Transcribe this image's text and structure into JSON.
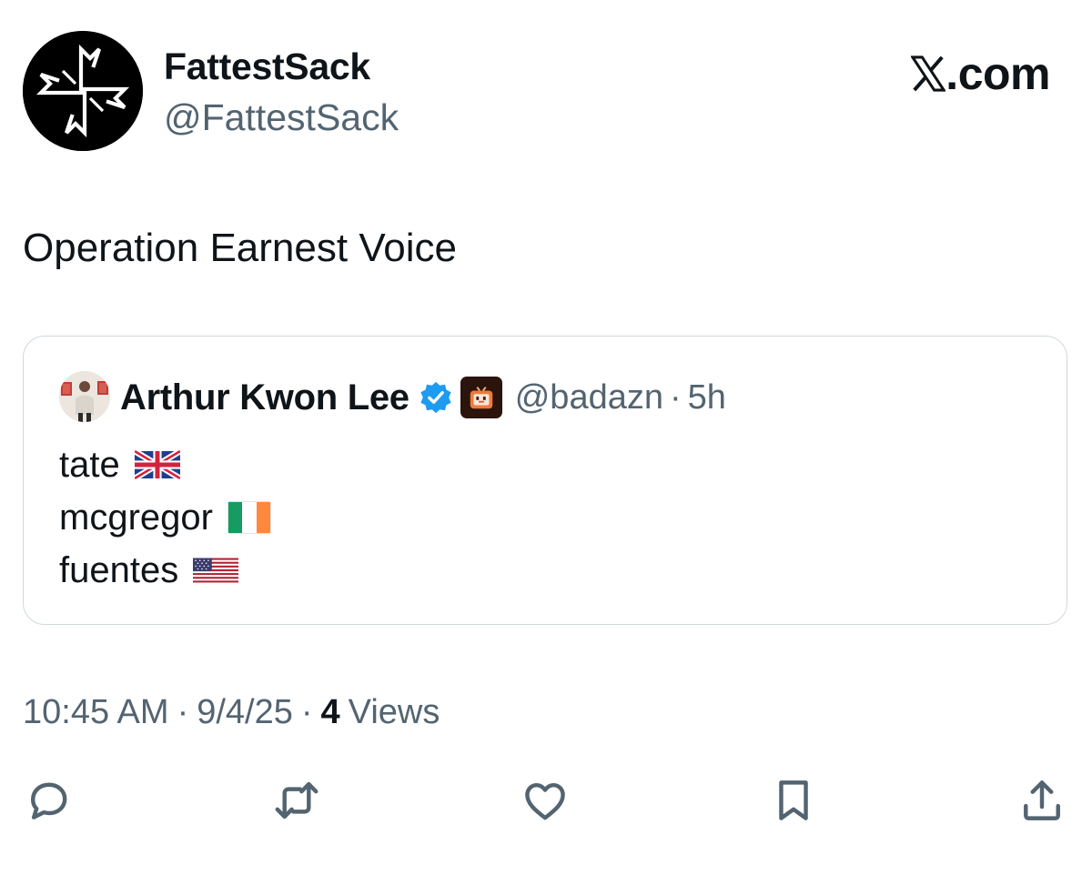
{
  "author": {
    "display_name": "FattestSack",
    "handle": "@FattestSack",
    "avatar_icon": "compass-star-logo"
  },
  "brand": {
    "text": ".com",
    "icon": "x-logo-icon"
  },
  "tweet": {
    "text": "Operation Earnest Voice"
  },
  "quote": {
    "display_name": "Arthur Kwon Lee",
    "handle": "@badazn",
    "separator": "·",
    "time": "5h",
    "badges": [
      "verified-icon",
      "affiliate-badge-icon"
    ],
    "lines": [
      {
        "text": "tate",
        "flag": "uk-flag-icon"
      },
      {
        "text": "mcgregor",
        "flag": "ireland-flag-icon"
      },
      {
        "text": "fuentes",
        "flag": "us-flag-icon"
      }
    ]
  },
  "meta": {
    "time": "10:45 AM",
    "separator": "·",
    "date": "9/4/25",
    "views_count": "4",
    "views_label": "Views"
  },
  "actions": [
    "reply-icon",
    "repost-icon",
    "like-icon",
    "bookmark-icon",
    "share-icon"
  ],
  "colors": {
    "text_primary": "#0f1419",
    "text_secondary": "#536471",
    "border": "#cfd9de",
    "verified_blue": "#1d9bf0"
  }
}
